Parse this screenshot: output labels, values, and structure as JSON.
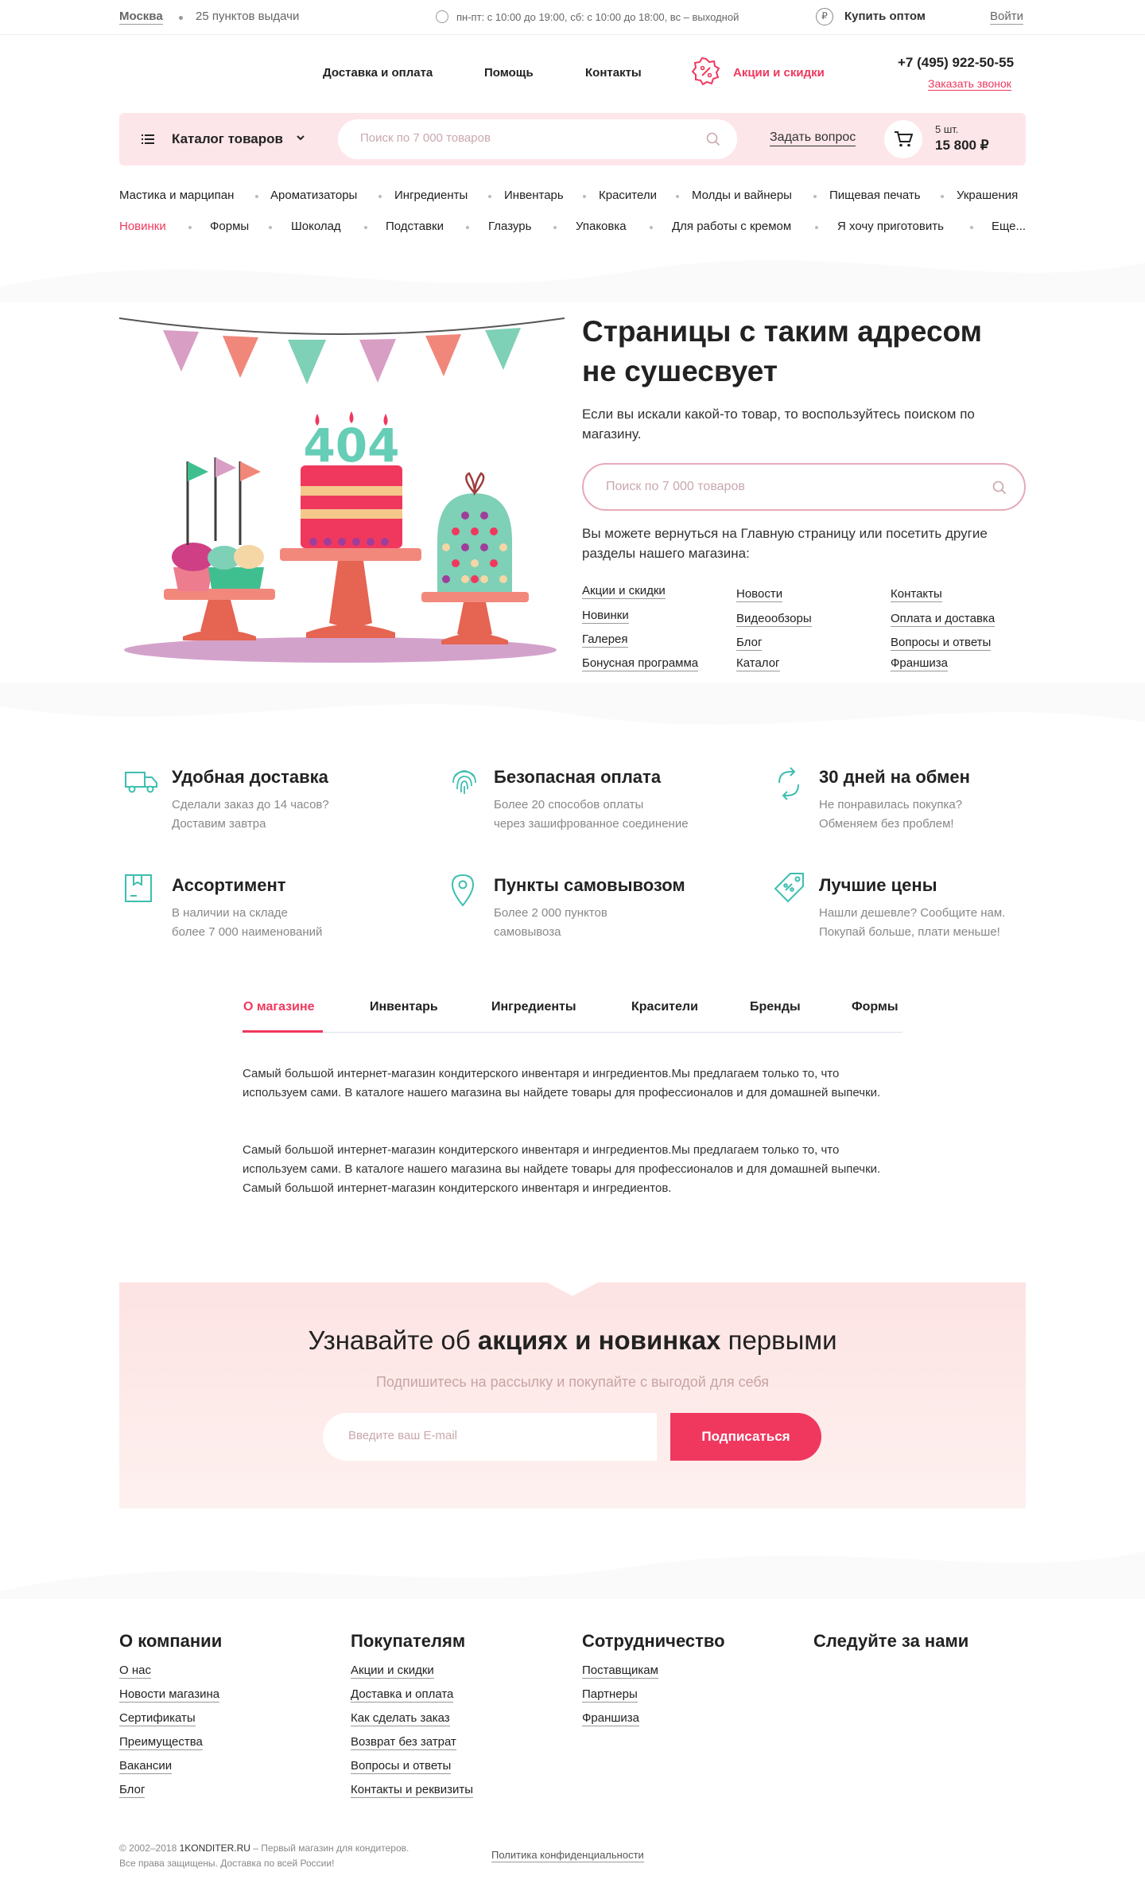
{
  "topbar": {
    "city": "Москва",
    "pickup": "25 пунктов выдачи",
    "hours": "пн-пт: с 10:00 до 19:00, сб: с 10:00 до 18:00, вс – выходной",
    "wholesale": "Купить оптом",
    "login": "Войти"
  },
  "header": {
    "nav": [
      "Доставка и оплата",
      "Помощь",
      "Контакты"
    ],
    "promo": "Акции и скидки",
    "phone": "+7 (495) 922-50-55",
    "callback": "Заказать звонок"
  },
  "bar": {
    "catalog": "Каталог товаров",
    "search_placeholder": "Поиск по 7 000 товаров",
    "ask": "Задать вопрос",
    "cart_count": "5 шт.",
    "cart_total": "15 800 ₽"
  },
  "categories_row1": [
    "Мастика и марципан",
    "Ароматизаторы",
    "Ингредиенты",
    "Инвентарь",
    "Красители",
    "Молды и вайнеры",
    "Пищевая печать",
    "Украшения"
  ],
  "categories_row2": [
    "Новинки",
    "Формы",
    "Шоколад",
    "Подставки",
    "Глазурь",
    "Упаковка",
    "Для работы с кремом",
    "Я хочу приготовить",
    "Еще..."
  ],
  "error": {
    "code": "404",
    "title_line1": "Страницы с таким адресом",
    "title_line2": "не сушесвует",
    "text": "Если вы искали какой-то товар, то воспользуйтесь поиском по магазину.",
    "search_placeholder": "Поиск по 7 000 товаров",
    "text2": "Вы можете вернуться на Главную страницу или посетить другие разделы нашего магазина:",
    "links_col1": [
      "Акции и скидки",
      "Новинки",
      "Галерея",
      "Бонусная программа"
    ],
    "links_col2": [
      "Новости",
      "Видеообзоры",
      "Блог",
      "Каталог"
    ],
    "links_col3": [
      "Контакты",
      "Оплата и доставка",
      "Вопросы и ответы",
      "Франшиза"
    ]
  },
  "features": [
    {
      "icon": "truck-icon",
      "title": "Удобная доставка",
      "l1": "Сделали заказ до 14 часов?",
      "l2": "Доставим завтра"
    },
    {
      "icon": "fingerprint-icon",
      "title": "Безопасная оплата",
      "l1": "Более 20 способов оплаты",
      "l2": "через зашифрованное соединение"
    },
    {
      "icon": "exchange-icon",
      "title": "30 дней на обмен",
      "l1": "Не понравилась покупка?",
      "l2": "Обменяем без проблем!"
    },
    {
      "icon": "box-icon",
      "title": "Ассортимент",
      "l1": "В наличии на складе",
      "l2": "более 7 000 наименований"
    },
    {
      "icon": "location-pin-icon",
      "title": "Пункты самовывозом",
      "l1": "Более 2 000 пунктов",
      "l2": "самовывоза"
    },
    {
      "icon": "price-tag-icon",
      "title": "Лучшие цены",
      "l1": "Нашли дешевле? Сообщите нам.",
      "l2": "Покупай больше, плати меньше!"
    }
  ],
  "tabs": [
    "О магазине",
    "Инвентарь",
    "Ингредиенты",
    "Красители",
    "Бренды",
    "Формы"
  ],
  "about": {
    "p1": "Самый большой интернет-магазин кондитерского инвентаря и ингредиентов.Мы предлагаем только то, что используем сами. В каталоге нашего магазина вы найдете товары для профессионалов и для домашней выпечки.",
    "p2": "Самый большой интернет-магазин кондитерского инвентаря и ингредиентов.Мы предлагаем только то, что используем сами. В каталоге нашего магазина вы найдете товары для профессионалов и для домашней выпечки. Самый большой интернет-магазин кондитерского инвентаря и ингредиентов."
  },
  "subscribe": {
    "title_pre": "Узнавайте об ",
    "title_bold": "акциях и новинках",
    "title_post": " первыми",
    "sub": "Подпишитесь на рассылку и покупайте с выгодой для себя",
    "placeholder": "Введите ваш E-mail",
    "button": "Подписаться"
  },
  "footer": {
    "col1_title": "О компании",
    "col1": [
      "О нас",
      "Новости магазина",
      "Сертификаты",
      "Преимущества",
      "Вакансии",
      "Блог"
    ],
    "col2_title": "Покупателям",
    "col2": [
      "Акции и скидки",
      "Доставка и оплата",
      "Как сделать заказ",
      "Возврат без затрат",
      "Вопросы и ответы",
      "Контакты и реквизиты"
    ],
    "col3_title": "Сотрудничество",
    "col3": [
      "Поставщикам",
      "Партнеры",
      "Франшиза"
    ],
    "col4_title": "Следуйте за нами",
    "copy1_pre": "© 2002–2018 ",
    "copy1_brand": "1KONDITER.RU",
    "copy1_post": " – Первый магазин для кондитеров.",
    "copy2": "Все права защищены. Доставка по всей России!",
    "privacy": "Политика конфиденциальности"
  },
  "colors": {
    "accent": "#f0385f",
    "pink_bg": "#fde6ea",
    "teal": "#3cbfb0"
  }
}
